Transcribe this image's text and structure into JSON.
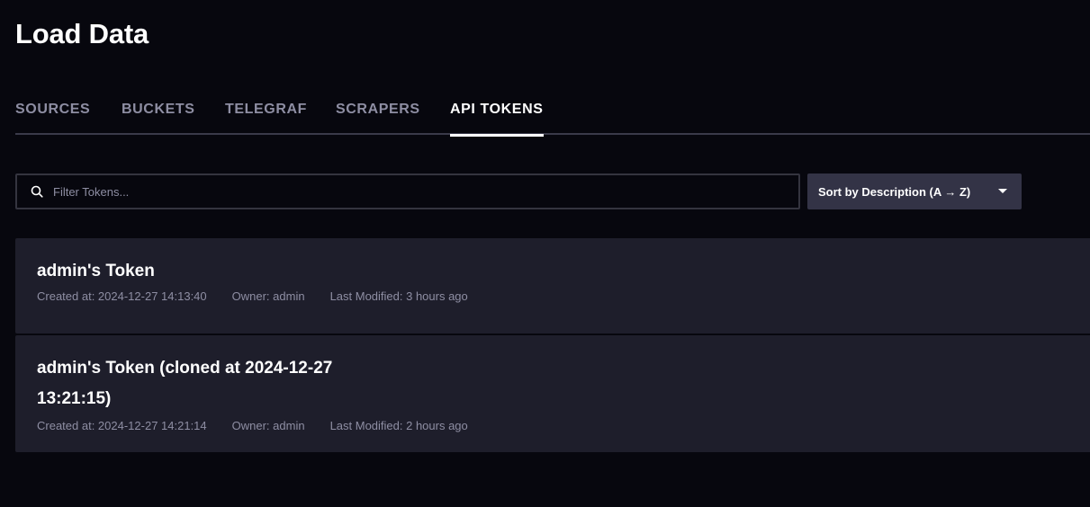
{
  "header": {
    "title": "Load Data"
  },
  "tabs": [
    {
      "label": "SOURCES",
      "active": false
    },
    {
      "label": "BUCKETS",
      "active": false
    },
    {
      "label": "TELEGRAF",
      "active": false
    },
    {
      "label": "SCRAPERS",
      "active": false
    },
    {
      "label": "API TOKENS",
      "active": true
    }
  ],
  "filter": {
    "placeholder": "Filter Tokens...",
    "value": "",
    "icon": "search-icon"
  },
  "sort": {
    "label": "Sort by Description (A → Z)",
    "icon": "chevron-down-icon"
  },
  "tokens": [
    {
      "name": "admin's Token",
      "created": "Created at: 2024-12-27 14:13:40",
      "owner": "Owner: admin",
      "modified": "Last Modified: 3 hours ago"
    },
    {
      "name": "admin's Token (cloned at 2024-12-27 13:21:15)",
      "created": "Created at: 2024-12-27 14:21:14",
      "owner": "Owner: admin",
      "modified": "Last Modified: 2 hours ago"
    }
  ],
  "colors": {
    "background": "#07070e",
    "card": "#1e1e2b",
    "muted_text": "#8e8ea3",
    "dropdown": "#333346"
  }
}
